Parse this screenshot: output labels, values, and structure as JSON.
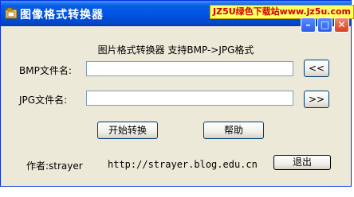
{
  "window": {
    "title": "图像格式转换器",
    "watermark": "JZ5U绿色下载站www.jz5u.com",
    "controls": {
      "minimize": "–",
      "maximize": "□",
      "close": "✕"
    }
  },
  "subtitle": "图片格式转换器 支持BMP->JPG格式",
  "bmp": {
    "label": "BMP文件名:",
    "value": "",
    "button_label": "<<"
  },
  "jpg": {
    "label": "JPG文件名:",
    "value": "",
    "button_label": ">>"
  },
  "actions": {
    "start_label": "开始转换",
    "help_label": "帮助",
    "exit_label": "退出"
  },
  "footer": {
    "author": "作者:strayer",
    "url": "http://strayer.blog.edu.cn"
  },
  "icons": {
    "app": "converter-app-icon"
  }
}
